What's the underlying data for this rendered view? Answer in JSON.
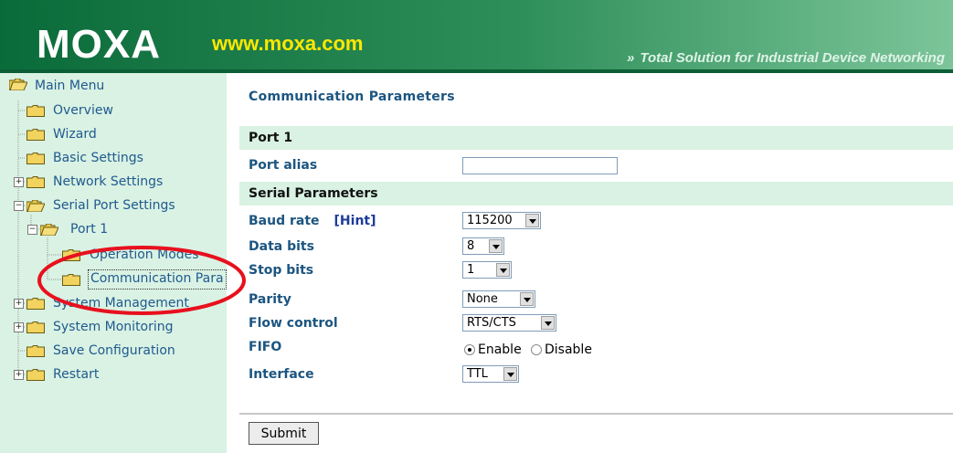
{
  "header": {
    "logo_text": "MOXA",
    "url_text": "www.moxa.com",
    "tagline_arrows": "»",
    "tagline": "Total Solution for Industrial Device Networking"
  },
  "sidebar": {
    "items": [
      {
        "label": "Main Menu",
        "expander": ""
      },
      {
        "label": "Overview",
        "expander": ""
      },
      {
        "label": "Wizard",
        "expander": ""
      },
      {
        "label": "Basic Settings",
        "expander": ""
      },
      {
        "label": "Network Settings",
        "expander": "+"
      },
      {
        "label": "Serial Port Settings",
        "expander": "−"
      },
      {
        "label": "Port 1",
        "expander": "−"
      },
      {
        "label": "Operation Modes",
        "expander": ""
      },
      {
        "label": "Communication Para",
        "expander": ""
      },
      {
        "label": "System Management",
        "expander": "+"
      },
      {
        "label": "System Monitoring",
        "expander": "+"
      },
      {
        "label": "Save Configuration",
        "expander": ""
      },
      {
        "label": "Restart",
        "expander": "+"
      }
    ]
  },
  "main": {
    "title": "Communication Parameters",
    "port_section": "Port 1",
    "port_alias_label": "Port alias",
    "port_alias_value": "",
    "serial_section": "Serial Parameters",
    "baud_rate_label": "Baud rate",
    "hint_label": "[Hint]",
    "baud_rate_value": "115200",
    "data_bits_label": "Data bits",
    "data_bits_value": "8",
    "stop_bits_label": "Stop bits",
    "stop_bits_value": "1",
    "parity_label": "Parity",
    "parity_value": "None",
    "flow_control_label": "Flow control",
    "flow_control_value": "RTS/CTS",
    "fifo_label": "FIFO",
    "fifo_enable_label": "Enable",
    "fifo_disable_label": "Disable",
    "fifo_selected": "Enable",
    "interface_label": "Interface",
    "interface_value": "TTL",
    "submit_label": "Submit"
  },
  "colors": {
    "header_gradient_start": "#0a6b3a",
    "header_gradient_end": "#6dbf8c",
    "sidebar_bg": "#d9f2e3",
    "label_blue": "#1c5580",
    "annotation_red": "#e8101e"
  }
}
